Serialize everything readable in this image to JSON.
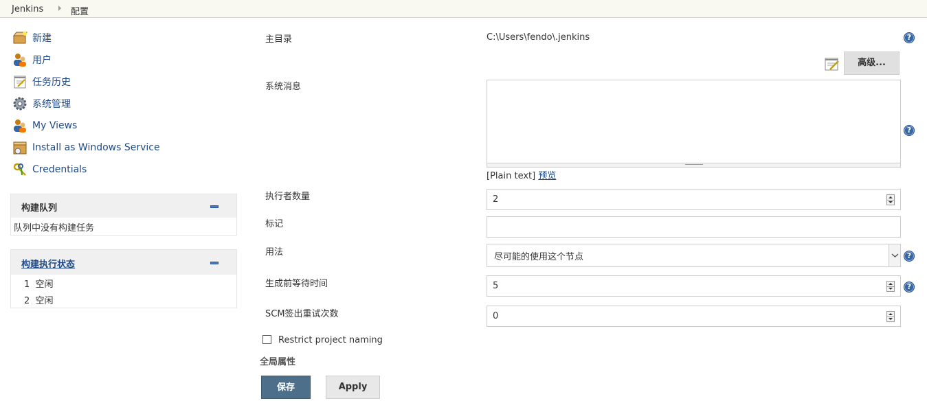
{
  "breadcrumb": {
    "items": [
      "Jenkins",
      "配置"
    ]
  },
  "tasks": [
    {
      "label": "新建"
    },
    {
      "label": "用户"
    },
    {
      "label": "任务历史"
    },
    {
      "label": "系统管理"
    },
    {
      "label": "My Views"
    },
    {
      "label": "Install as Windows Service"
    },
    {
      "label": "Credentials"
    }
  ],
  "build_queue": {
    "title": "构建队列",
    "empty_text": "队列中没有构建任务"
  },
  "executors": {
    "title": "构建执行状态",
    "rows": [
      {
        "num": "1",
        "status": "空闲"
      },
      {
        "num": "2",
        "status": "空闲"
      }
    ]
  },
  "form": {
    "home_label": "主目录",
    "home_value": "C:\\Users\\fendo\\.jenkins",
    "advanced_button": "高级...",
    "system_message_label": "系统消息",
    "system_message_value": "",
    "markup_format": "[Plain text]",
    "preview_link": "预览",
    "executors_label": "执行者数量",
    "executors_value": "2",
    "labels_label": "标记",
    "labels_value": "",
    "usage_label": "用法",
    "usage_value": "尽可能的使用这个节点",
    "quiet_period_label": "生成前等待时间",
    "quiet_period_value": "5",
    "scm_retry_label": "SCM签出重试次数",
    "scm_retry_value": "0",
    "restrict_naming_label": "Restrict project naming",
    "restrict_naming_checked": false,
    "global_properties_label": "全局属性",
    "save_button": "保存",
    "apply_button": "Apply",
    "help_glyph": "?"
  },
  "colors": {
    "link": "#204a87",
    "save_button_bg": "#4d6f8a",
    "help_icon": "#3465a4",
    "breadcrumb_bg": "#f9f9f2",
    "pane_head_bg": "#f0f0f0"
  }
}
